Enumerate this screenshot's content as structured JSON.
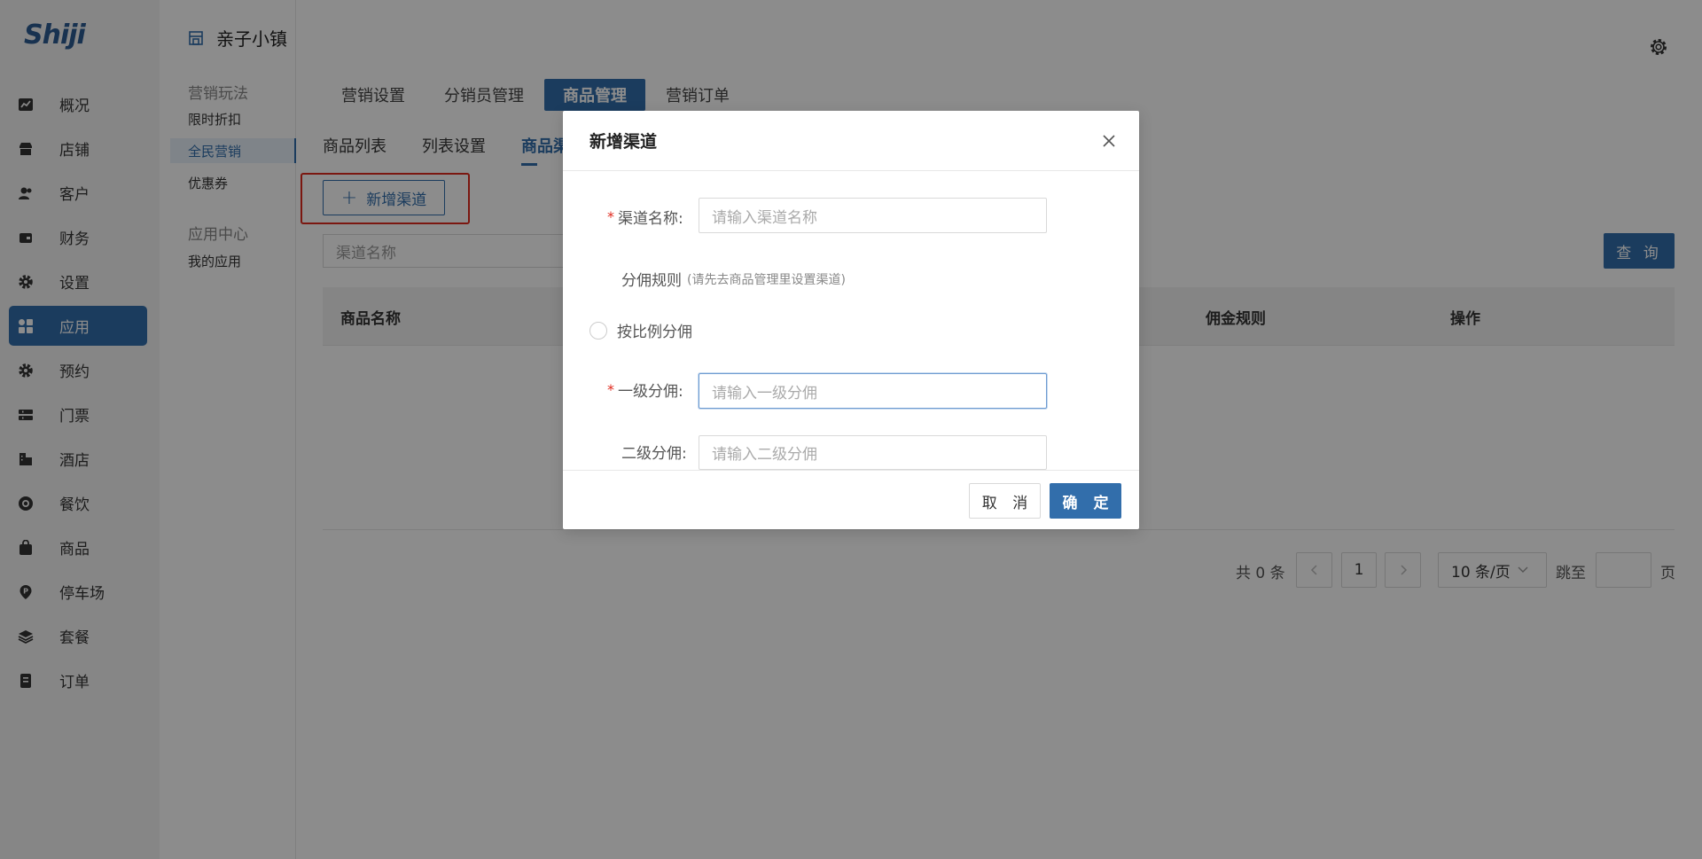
{
  "brand": {
    "logo_text": "Shiji"
  },
  "header": {
    "title": "亲子小镇",
    "settings_icon": "gear-icon"
  },
  "sidebar": {
    "items": [
      {
        "label": "概况",
        "icon": "dashboard-icon"
      },
      {
        "label": "店铺",
        "icon": "store-icon"
      },
      {
        "label": "客户",
        "icon": "users-icon"
      },
      {
        "label": "财务",
        "icon": "wallet-icon"
      },
      {
        "label": "设置",
        "icon": "gear-icon"
      },
      {
        "label": "应用",
        "icon": "apps-icon",
        "active": true
      },
      {
        "label": "预约",
        "icon": "gear-icon"
      },
      {
        "label": "门票",
        "icon": "ticket-icon"
      },
      {
        "label": "酒店",
        "icon": "building-icon"
      },
      {
        "label": "餐饮",
        "icon": "dining-icon"
      },
      {
        "label": "商品",
        "icon": "bag-icon"
      },
      {
        "label": "停车场",
        "icon": "parking-icon"
      },
      {
        "label": "套餐",
        "icon": "layers-icon"
      },
      {
        "label": "订单",
        "icon": "document-icon"
      }
    ]
  },
  "subnav": {
    "group1_title": "营销玩法",
    "group1_items": [
      "限时折扣",
      "全民营销",
      "优惠券"
    ],
    "group2_title": "应用中心",
    "group2_items": [
      "我的应用"
    ]
  },
  "tabs_primary": [
    "营销设置",
    "分销员管理",
    "商品管理",
    "营销订单"
  ],
  "tabs_secondary": [
    "商品列表",
    "列表设置",
    "商品渠"
  ],
  "toolbar": {
    "add_label": "新增渠道",
    "search_placeholder": "渠道名称",
    "query_label": "查 询"
  },
  "table": {
    "headers": [
      "商品名称",
      "佣金规则",
      "操作"
    ]
  },
  "pagination": {
    "total_text": "共 0 条",
    "current_page": "1",
    "page_size": "10 条/页",
    "jump_label": "跳至",
    "page_suffix": "页"
  },
  "modal": {
    "title": "新增渠道",
    "channel_name_label": "渠道名称:",
    "channel_name_placeholder": "请输入渠道名称",
    "rule_title": "分佣规则",
    "rule_hint": "(请先去商品管理里设置渠道)",
    "radio_label": "按比例分佣",
    "level1_label": "一级分佣:",
    "level1_placeholder": "请输入一级分佣",
    "level2_label": "二级分佣:",
    "level2_placeholder": "请输入二级分佣",
    "cancel_label": "取 消",
    "ok_label": "确 定"
  },
  "colors": {
    "primary": "#326eab",
    "danger": "#e02a1e",
    "sidebar_bg": "#f4f4f4"
  }
}
